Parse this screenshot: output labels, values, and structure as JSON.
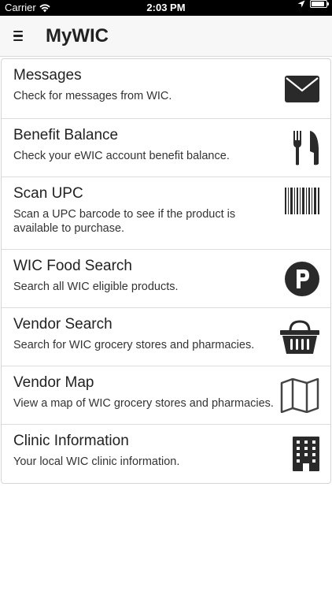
{
  "status": {
    "carrier": "Carrier",
    "time": "2:03 PM",
    "battery_level": 0.9
  },
  "nav": {
    "title": "MyWIC",
    "menu_icon": "hamburger-icon"
  },
  "items": [
    {
      "title": "Messages",
      "description": "Check for messages from WIC.",
      "icon": "envelope-icon"
    },
    {
      "title": "Benefit Balance",
      "description": "Check your eWIC account benefit balance.",
      "icon": "fork-knife-icon"
    },
    {
      "title": "Scan UPC",
      "description": "Scan a UPC barcode to see if the product is available to purchase.",
      "icon": "barcode-icon"
    },
    {
      "title": "WIC Food Search",
      "description": "Search all WIC eligible products.",
      "icon": "p-circle-icon"
    },
    {
      "title": "Vendor Search",
      "description": "Search for WIC grocery stores and pharmacies.",
      "icon": "basket-icon"
    },
    {
      "title": "Vendor Map",
      "description": "View a map of WIC grocery stores and pharmacies.",
      "icon": "map-icon"
    },
    {
      "title": "Clinic Information",
      "description": "Your local WIC clinic information.",
      "icon": "building-icon"
    }
  ]
}
